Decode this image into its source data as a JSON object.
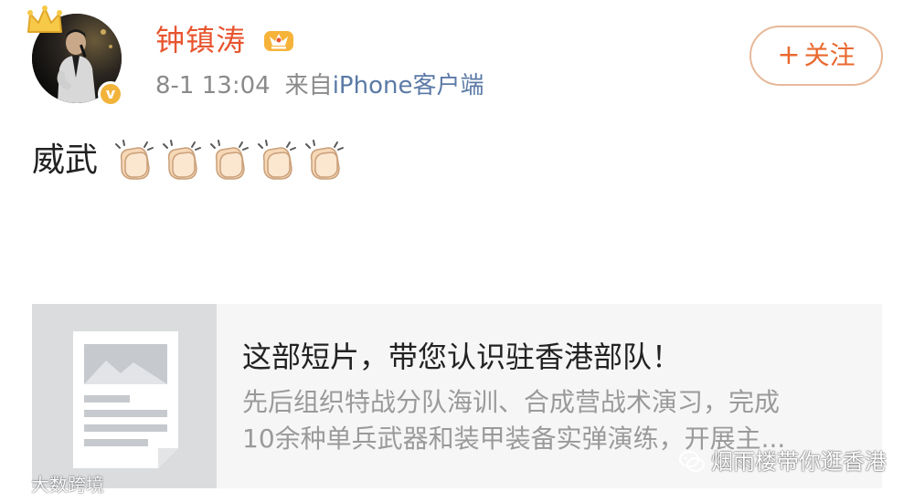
{
  "post": {
    "author": "钟镇涛",
    "time": "8-1 13:04",
    "source_prefix": "来自",
    "source": "iPhone客户端",
    "follow_label": "关注",
    "follow_plus": "+",
    "text": "威武",
    "emoji_count": 5,
    "verified_mark": "v"
  },
  "card": {
    "title": "这部短片，带您认识驻香港部队！",
    "desc_line1": "先后组织特战分队海训、合成营战术演习，完成",
    "desc_line2": "10余种单兵武器和装甲装备实弹演练，开展主..."
  },
  "watermarks": {
    "left": "大数跨境",
    "right": "烟雨楼带你逛香港"
  },
  "colors": {
    "author": "#e8552f",
    "follow": "#e8692f",
    "source": "#5b7aa6",
    "verified": "#f2b33b"
  }
}
